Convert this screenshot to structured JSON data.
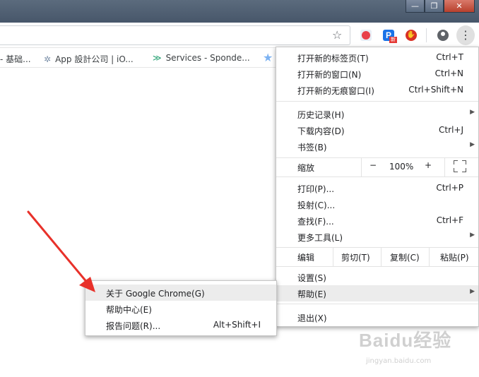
{
  "window": {
    "buttons": [
      {
        "name": "minimize",
        "glyph": "—"
      },
      {
        "name": "maximize",
        "glyph": "❐"
      },
      {
        "name": "close",
        "glyph": "✕"
      }
    ]
  },
  "toolbar": {
    "bookmark_star_icon": "star-icon",
    "ext2_letter": "P",
    "ext2_badge": "新",
    "ext3_glyph": "✋",
    "menu_icon": "⋮"
  },
  "bookmarks": [
    {
      "label": "- 基础...",
      "icon": ""
    },
    {
      "label": "App 設計公司 | iO...",
      "icon": "✲"
    },
    {
      "label": "Services - Sponde...",
      "icon": "≫"
    }
  ],
  "menu": {
    "items": [
      {
        "label": "打开新的标签页(T)",
        "shortcut": "Ctrl+T"
      },
      {
        "label": "打开新的窗口(N)",
        "shortcut": "Ctrl+N"
      },
      {
        "label": "打开新的无痕窗口(I)",
        "shortcut": "Ctrl+Shift+N"
      },
      {
        "label": "历史记录(H)",
        "shortcut": ""
      },
      {
        "label": "下载内容(D)",
        "shortcut": "Ctrl+J"
      },
      {
        "label": "书签(B)",
        "shortcut": ""
      },
      {
        "label": "打印(P)...",
        "shortcut": "Ctrl+P"
      },
      {
        "label": "投射(C)...",
        "shortcut": ""
      },
      {
        "label": "查找(F)...",
        "shortcut": "Ctrl+F"
      },
      {
        "label": "更多工具(L)",
        "shortcut": ""
      },
      {
        "label": "设置(S)",
        "shortcut": ""
      },
      {
        "label": "帮助(E)",
        "shortcut": ""
      },
      {
        "label": "退出(X)",
        "shortcut": ""
      }
    ],
    "zoom": {
      "label": "缩放",
      "minus": "−",
      "value": "100%",
      "plus": "+"
    },
    "edit": {
      "label": "编辑",
      "cut": "剪切(T)",
      "copy": "复制(C)",
      "paste": "粘贴(P)"
    }
  },
  "help_submenu": {
    "items": [
      {
        "label": "关于 Google Chrome(G)",
        "shortcut": ""
      },
      {
        "label": "帮助中心(E)",
        "shortcut": ""
      },
      {
        "label": "报告问题(R)...",
        "shortcut": "Alt+Shift+I"
      }
    ]
  },
  "annotation": {
    "arrow_color": "#e8312a"
  },
  "watermark": {
    "text": "Baidu经验",
    "sub": "jingyan.baidu.com"
  }
}
